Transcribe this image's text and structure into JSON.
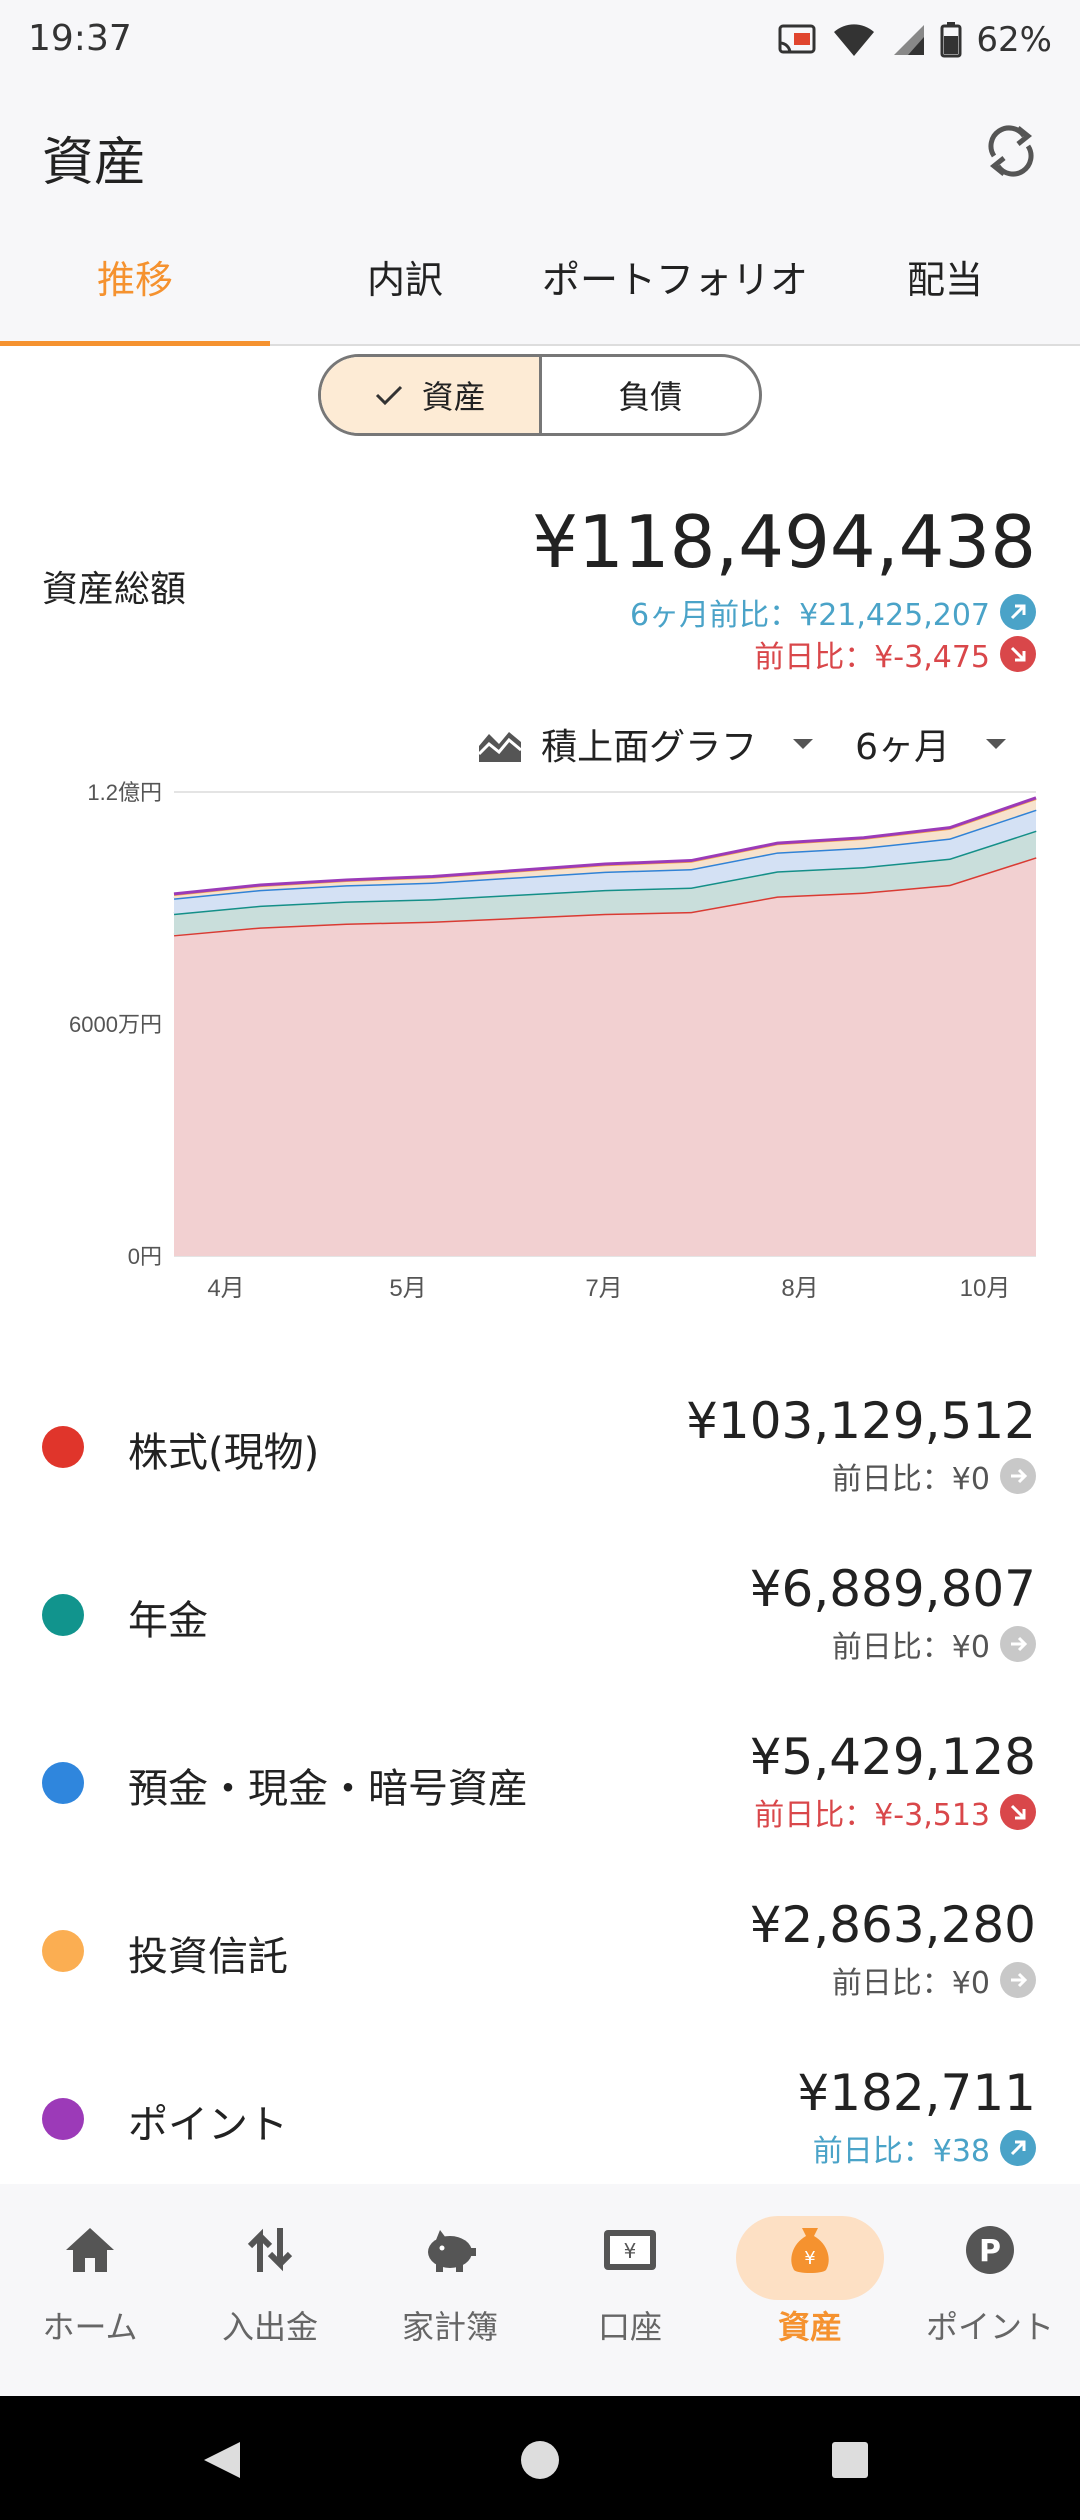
{
  "status": {
    "time": "19:37",
    "battery": "62%"
  },
  "header": {
    "title": "資産"
  },
  "tabs": [
    "推移",
    "内訳",
    "ポートフォリオ",
    "配当"
  ],
  "toggle": {
    "assets": "資産",
    "liabilities": "負債"
  },
  "summary": {
    "label": "資産総額",
    "total": "¥118,494,438",
    "six_month": "6ヶ月前比：¥21,425,207",
    "prev_day": "前日比：¥-3,475"
  },
  "chart_controls": {
    "type": "積上面グラフ",
    "period": "6ヶ月"
  },
  "chart_data": {
    "type": "area",
    "stacked": true,
    "y_tick_labels": [
      "1.2億円",
      "6000万円",
      "0円"
    ],
    "x_tick_labels": [
      "4月",
      "5月",
      "7月",
      "8月",
      "10月"
    ],
    "x": [
      "3月下旬",
      "4月中旬",
      "5月上旬",
      "5月下旬",
      "6月中旬",
      "7月上旬",
      "7月下旬",
      "8月中旬",
      "9月上旬",
      "9月下旬",
      "10月中旬"
    ],
    "ylim": [
      0,
      120000000
    ],
    "series": [
      {
        "name": "株式(現物)",
        "color": "#d93b33",
        "fill": "#f2d0d1",
        "values": [
          83000000,
          85000000,
          86000000,
          86500000,
          87500000,
          88500000,
          89000000,
          93000000,
          94000000,
          96000000,
          103129512
        ]
      },
      {
        "name": "年金",
        "color": "#148f88",
        "fill": "#c9dedb",
        "values": [
          5500000,
          5600000,
          5700000,
          5800000,
          6000000,
          6200000,
          6300000,
          6500000,
          6600000,
          6800000,
          6889807
        ]
      },
      {
        "name": "預金・現金・暗号資産",
        "color": "#3082d6",
        "fill": "#d4e1f4",
        "values": [
          4000000,
          4100000,
          4200000,
          4300000,
          4500000,
          4700000,
          4800000,
          4900000,
          5000000,
          5200000,
          5429128
        ]
      },
      {
        "name": "投資信託",
        "color": "#f6a54a",
        "fill": "#f7e2cd",
        "values": [
          1000000,
          1100000,
          1200000,
          1400000,
          1600000,
          1800000,
          2000000,
          2200000,
          2400000,
          2600000,
          2863280
        ]
      },
      {
        "name": "ポイント",
        "color": "#9b3bb8",
        "fill": "#e8d4ef",
        "values": [
          150000,
          155000,
          158000,
          160000,
          163000,
          166000,
          170000,
          173000,
          176000,
          179000,
          182711
        ]
      }
    ]
  },
  "assets": [
    {
      "name": "株式(現物)",
      "color": "#e0352b",
      "value": "¥103,129,512",
      "cmp": "前日比：¥0",
      "trend": "flat"
    },
    {
      "name": "年金",
      "color": "#11948d",
      "value": "¥6,889,807",
      "cmp": "前日比：¥0",
      "trend": "flat"
    },
    {
      "name": "預金・現金・暗号資産",
      "color": "#2f86dd",
      "value": "¥5,429,128",
      "cmp": "前日比：¥-3,513",
      "trend": "down"
    },
    {
      "name": "投資信託",
      "color": "#fbae52",
      "value": "¥2,863,280",
      "cmp": "前日比：¥0",
      "trend": "flat"
    },
    {
      "name": "ポイント",
      "color": "#9c3ab8",
      "value": "¥182,711",
      "cmp": "前日比：¥38",
      "trend": "up"
    }
  ],
  "bottom_nav": [
    "ホーム",
    "入出金",
    "家計簿",
    "口座",
    "資産",
    "ポイント"
  ]
}
